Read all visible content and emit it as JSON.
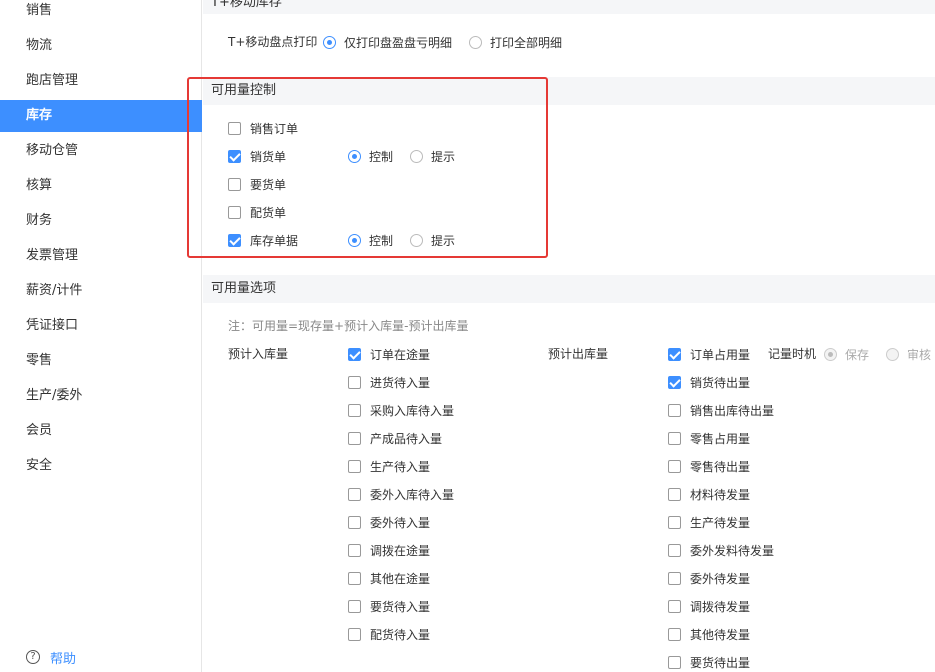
{
  "sidebar": {
    "items": [
      {
        "label": "销售",
        "active": false
      },
      {
        "label": "物流",
        "active": false
      },
      {
        "label": "跑店管理",
        "active": false
      },
      {
        "label": "库存",
        "active": true
      },
      {
        "label": "移动仓管",
        "active": false
      },
      {
        "label": "核算",
        "active": false
      },
      {
        "label": "财务",
        "active": false
      },
      {
        "label": "发票管理",
        "active": false
      },
      {
        "label": "薪资/计件",
        "active": false
      },
      {
        "label": "凭证接口",
        "active": false
      },
      {
        "label": "零售",
        "active": false
      },
      {
        "label": "生产/委外",
        "active": false
      },
      {
        "label": "会员",
        "active": false
      },
      {
        "label": "安全",
        "active": false
      }
    ],
    "help_label": "帮助",
    "help_icon": "?"
  },
  "mobile_stock": {
    "title": "T+移动库存",
    "print_label": "T+移动盘点打印",
    "options": [
      {
        "label": "仅打印盘盈盘亏明细",
        "checked": true
      },
      {
        "label": "打印全部明细",
        "checked": false
      }
    ]
  },
  "available_control": {
    "title": "可用量控制",
    "items": [
      {
        "label": "销售订单",
        "checked": false,
        "radios": null
      },
      {
        "label": "销货单",
        "checked": true,
        "radios": [
          {
            "label": "控制",
            "checked": true
          },
          {
            "label": "提示",
            "checked": false
          }
        ]
      },
      {
        "label": "要货单",
        "checked": false,
        "radios": null
      },
      {
        "label": "配货单",
        "checked": false,
        "radios": null
      },
      {
        "label": "库存单据",
        "checked": true,
        "radios": [
          {
            "label": "控制",
            "checked": true
          },
          {
            "label": "提示",
            "checked": false
          }
        ]
      }
    ]
  },
  "available_options": {
    "title": "可用量选项",
    "note": "注：可用量=现存量+预计入库量-预计出库量",
    "inbound_label": "预计入库量",
    "inbound_items": [
      {
        "label": "订单在途量",
        "checked": true
      },
      {
        "label": "进货待入量",
        "checked": false
      },
      {
        "label": "采购入库待入量",
        "checked": false
      },
      {
        "label": "产成品待入量",
        "checked": false
      },
      {
        "label": "生产待入量",
        "checked": false
      },
      {
        "label": "委外入库待入量",
        "checked": false
      },
      {
        "label": "委外待入量",
        "checked": false
      },
      {
        "label": "调拨在途量",
        "checked": false
      },
      {
        "label": "其他在途量",
        "checked": false
      },
      {
        "label": "要货待入量",
        "checked": false
      },
      {
        "label": "配货待入量",
        "checked": false
      }
    ],
    "outbound_label": "预计出库量",
    "outbound_items": [
      {
        "label": "订单占用量",
        "checked": true
      },
      {
        "label": "销货待出量",
        "checked": true
      },
      {
        "label": "销售出库待出量",
        "checked": false
      },
      {
        "label": "零售占用量",
        "checked": false
      },
      {
        "label": "零售待出量",
        "checked": false
      },
      {
        "label": "材料待发量",
        "checked": false
      },
      {
        "label": "生产待发量",
        "checked": false
      },
      {
        "label": "委外发料待发量",
        "checked": false
      },
      {
        "label": "委外待发量",
        "checked": false
      },
      {
        "label": "调拨待发量",
        "checked": false
      },
      {
        "label": "其他待发量",
        "checked": false
      },
      {
        "label": "要货待出量",
        "checked": false
      }
    ],
    "timing_label": "记量时机",
    "timing_options": [
      {
        "label": "保存",
        "checked": true
      },
      {
        "label": "审核",
        "checked": false
      }
    ]
  }
}
